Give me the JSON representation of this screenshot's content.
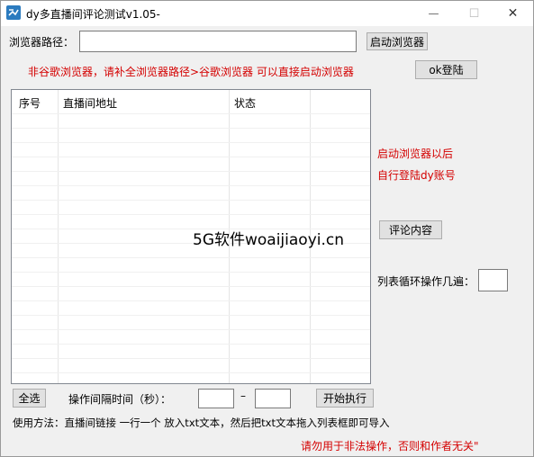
{
  "window": {
    "title": "dy多直播间评论测试v1.05-",
    "minimize_glyph": "—",
    "maximize_glyph": "☐",
    "close_glyph": "✕"
  },
  "browser": {
    "path_label": "浏览器路径：",
    "path_value": "",
    "start_button": "启动浏览器",
    "note": "非谷歌浏览器，请补全浏览器路径>谷歌浏览器 可以直接启动浏览器",
    "login_button": "ok登陆"
  },
  "list": {
    "columns": [
      "序号",
      "直播间地址",
      "状态"
    ]
  },
  "side": {
    "hint_line1": "启动浏览器以后",
    "hint_line2": "自行登陆dy账号",
    "comment_button": "评论内容",
    "loop_label": "列表循环操作几遍：",
    "loop_value": ""
  },
  "watermark": "5G软件woaijiaoyi.cn",
  "bottom": {
    "select_all_button": "全选",
    "interval_label": "操作间隔时间（秒）：",
    "interval_min": "",
    "dash": "–",
    "interval_max": "",
    "start_button": "开始执行",
    "usage": "使用方法：直播间链接 一行一个 放入txt文本，然后把txt文本拖入列表框即可导入",
    "warning": "请勿用于非法操作，否则和作者无关\""
  },
  "colors": {
    "accent_red": "#d40000",
    "app_icon": "#2b7bbf"
  }
}
